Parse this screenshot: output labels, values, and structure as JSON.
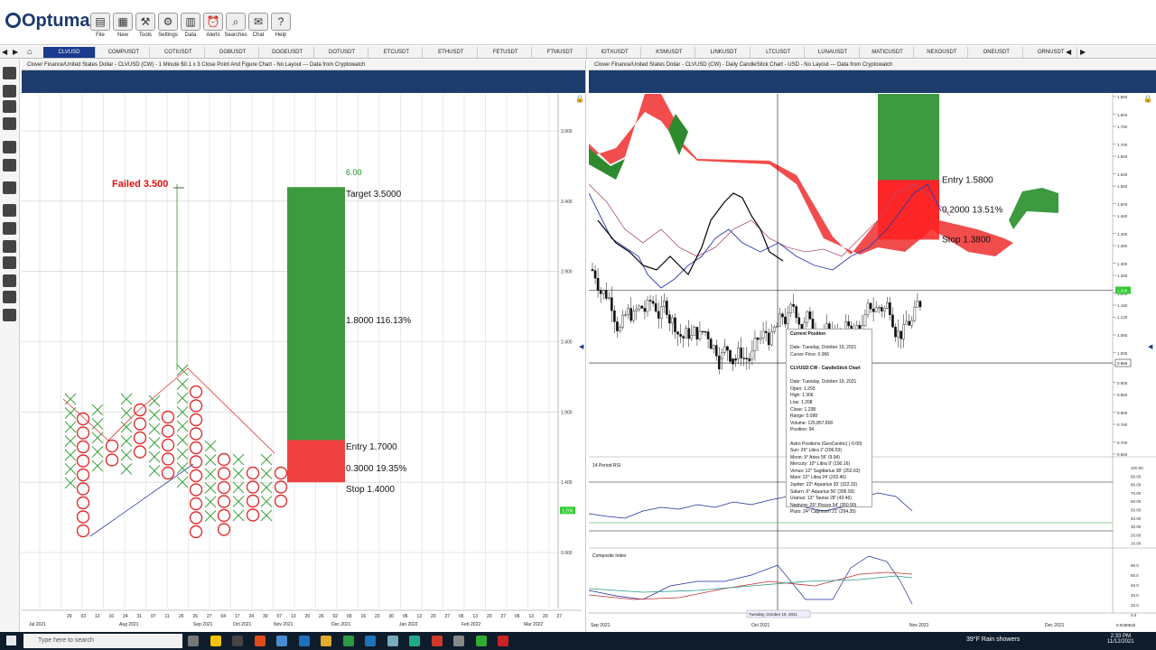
{
  "app": {
    "name": "Optuma"
  },
  "toolbar": {
    "buttons": [
      {
        "label": "File",
        "icon": "folder-icon"
      },
      {
        "label": "New",
        "icon": "new-icon"
      },
      {
        "label": "Tools",
        "icon": "tools-icon"
      },
      {
        "label": "Settings",
        "icon": "gear-icon"
      },
      {
        "label": "Data",
        "icon": "data-icon"
      },
      {
        "label": "Alerts",
        "icon": "alarm-icon"
      },
      {
        "label": "Searches",
        "icon": "search-icon"
      },
      {
        "label": "Chat",
        "icon": "chat-icon"
      },
      {
        "label": "Help",
        "icon": "help-icon"
      }
    ]
  },
  "tabs": [
    "CLVUSD",
    "COMPUSDT",
    "COTIUSDT",
    "DGBUSDT",
    "DOGEUSDT",
    "DOTUSDT",
    "ETCUSDT",
    "ETHUSDT",
    "FETUSDT",
    "FTMUSDT",
    "IOTXUSDT",
    "KSMUSDT",
    "LINKUSDT",
    "LTCUSDT",
    "LUNAUSDT",
    "MATICUSDT",
    "NEXOUSDT",
    "ONEUSDT",
    "ORNUSDT"
  ],
  "left_panel": {
    "title": "Clover Finance/United States Dollar - CLVUSD (CW) - 1 Minute $0.1 x 3 Close Point And Figure Chart - No Layout --- Data from Cryptowatch",
    "y_ticks": [
      "3.900",
      "3.400",
      "2.900",
      "2.400",
      "1.900",
      "1.400",
      "0.900"
    ],
    "price_badge": "1.200",
    "failed_label": "Failed 3.500",
    "ratio": "6.00",
    "target": "Target  3.5000",
    "gain": "1.8000  116.13%",
    "entry": "Entry  1.7000",
    "risk": "0.3000  19.35%",
    "stop": "Stop  1.4000",
    "x_days": [
      "29",
      "03",
      "12",
      "16",
      "24",
      "31",
      "07",
      "11",
      "26",
      "26",
      "27",
      "04",
      "17",
      "24",
      "30",
      "07",
      "13",
      "20",
      "26",
      "02",
      "09",
      "16",
      "23",
      "30",
      "06",
      "13",
      "20",
      "27",
      "06",
      "13",
      "20",
      "27",
      "06",
      "13",
      "20",
      "27"
    ],
    "x_months": [
      "Jul 2021",
      "Aug 2021",
      "Sep 2021",
      "Oct 2021",
      "Nov 2021",
      "Dec 2021",
      "Jan 2022",
      "Feb 2022",
      "Mar 2022"
    ]
  },
  "right_panel": {
    "title": "Clover Finance/United States Dollar - CLVUSD (CW) - Daily CandleStick Chart - USD - No Layout --- Data from Cryptowatch",
    "y_ticks": [
      "1.860",
      "1.800",
      "1.760",
      "1.700",
      "1.660",
      "1.600",
      "1.560",
      "1.500",
      "1.460",
      "1.400",
      "1.360",
      "1.300",
      "1.260",
      "1.200",
      "1.160",
      "1.120",
      "1.060",
      "1.000",
      "0.960",
      "0.900",
      "0.860",
      "0.800",
      "0.760",
      "0.700",
      "0.660"
    ],
    "entry": "Entry  1.5800",
    "risk": "0.2000  13.51%",
    "stop": "Stop  1.3800",
    "price_badge": "1.206",
    "cursor_badge": "0.966",
    "rsi_label": "14 Period RSI",
    "rsi_ticks": [
      "100.00",
      "90.00",
      "80.00",
      "70.00",
      "60.00",
      "50.00",
      "40.00",
      "30.00",
      "20.00",
      "10.00"
    ],
    "comp_label": "Composite Index",
    "comp_ticks": [
      "90.0",
      "80.0",
      "60.0",
      "40.0",
      "20.0",
      "0.0"
    ],
    "x_months": [
      "Sep 2021",
      "Oct 2021",
      "Nov 2021",
      "Dec 2021"
    ],
    "cursor_date": "Tuesday, October 19, 2021",
    "corner_value": "0.0190532",
    "tooltip": [
      {
        "t": "Current Position",
        "b": true
      },
      {
        "t": "",
        "b": false
      },
      {
        "t": "Date: Tuesday, October 19, 2021",
        "b": false
      },
      {
        "t": "Cursor Price: 0.966",
        "b": false
      },
      {
        "t": "",
        "b": false
      },
      {
        "t": "CLVUSD:CW - CandleStick Chart",
        "b": true
      },
      {
        "t": "",
        "b": false
      },
      {
        "t": "Date: Tuesday, October 19, 2021",
        "b": false
      },
      {
        "t": "Open: 1.293",
        "b": false
      },
      {
        "t": "High: 1.306",
        "b": false
      },
      {
        "t": "Low: 1.208",
        "b": false
      },
      {
        "t": "Close: 1.238",
        "b": false
      },
      {
        "t": "Range: 0.098",
        "b": false
      },
      {
        "t": "Volume: 125,857.800",
        "b": false
      },
      {
        "t": "Position: 94",
        "b": false
      },
      {
        "t": "",
        "b": false
      },
      {
        "t": "Astro Positions (GeoCentric) (-5:00)",
        "b": false
      },
      {
        "t": "Sun: 26° Libra 2' (206.03)",
        "b": false
      },
      {
        "t": "Moon: 9° Aries 56' (9.94)",
        "b": false
      },
      {
        "t": "Mercury: 10° Libra 9' (190.16)",
        "b": false
      },
      {
        "t": "Venus: 12° Sagittarius 38' (252.63)",
        "b": false
      },
      {
        "t": "Mars: 22° Libra 24' (202.40)",
        "b": false
      },
      {
        "t": "Jupiter: 22° Aquarius 20' (322.33)",
        "b": false
      },
      {
        "t": "Saturn: 6° Aquarius 56' (306.93)",
        "b": false
      },
      {
        "t": "Uranus: 13° Taurus 28' (43.46)",
        "b": false
      },
      {
        "t": "Neptune: 20° Pisces 54' (350.90)",
        "b": false
      },
      {
        "t": "Pluto: 24° Capricorn 21' (294.35)",
        "b": false
      }
    ]
  },
  "taskbar": {
    "search_placeholder": "Type here to search",
    "weather": "39°F  Rain showers",
    "time": "2:33 PM",
    "date": "11/12/2021"
  }
}
